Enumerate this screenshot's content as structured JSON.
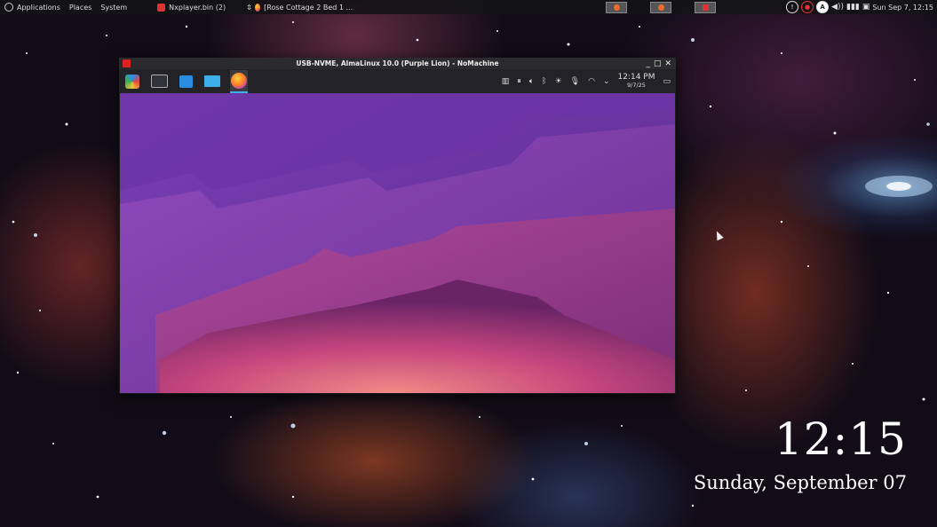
{
  "top_panel": {
    "menus": [
      "Applications",
      "Places",
      "System"
    ],
    "tasks": [
      {
        "label": "Nxplayer.bin (2)",
        "icon": "nomachine-icon"
      },
      {
        "label": "[Rose Cottage 2 Bed 1 ...",
        "icon": "firefox-icon"
      }
    ],
    "tray": {
      "clock": "Sun Sep 7, 12:15"
    }
  },
  "nx_window": {
    "title": "USB-NVME, AlmaLinux 10.0 (Purple Lion) - NoMachine",
    "controls": [
      "_",
      "□",
      "✕"
    ],
    "kde_panel": {
      "launchers": [
        "application-launcher-icon",
        "terminal-icon",
        "discover-icon",
        "file-manager-icon",
        "firefox-icon"
      ],
      "time": "12:14 PM",
      "date": "9/7/25"
    }
  },
  "desktop_clock": {
    "time": "12:15",
    "date": "Sunday, September 07"
  },
  "colors": {
    "kde_wallpaper_top": "#5a2a8a",
    "kde_wallpaper_bottom": "#e0607a",
    "panel_bg": "#141416"
  }
}
